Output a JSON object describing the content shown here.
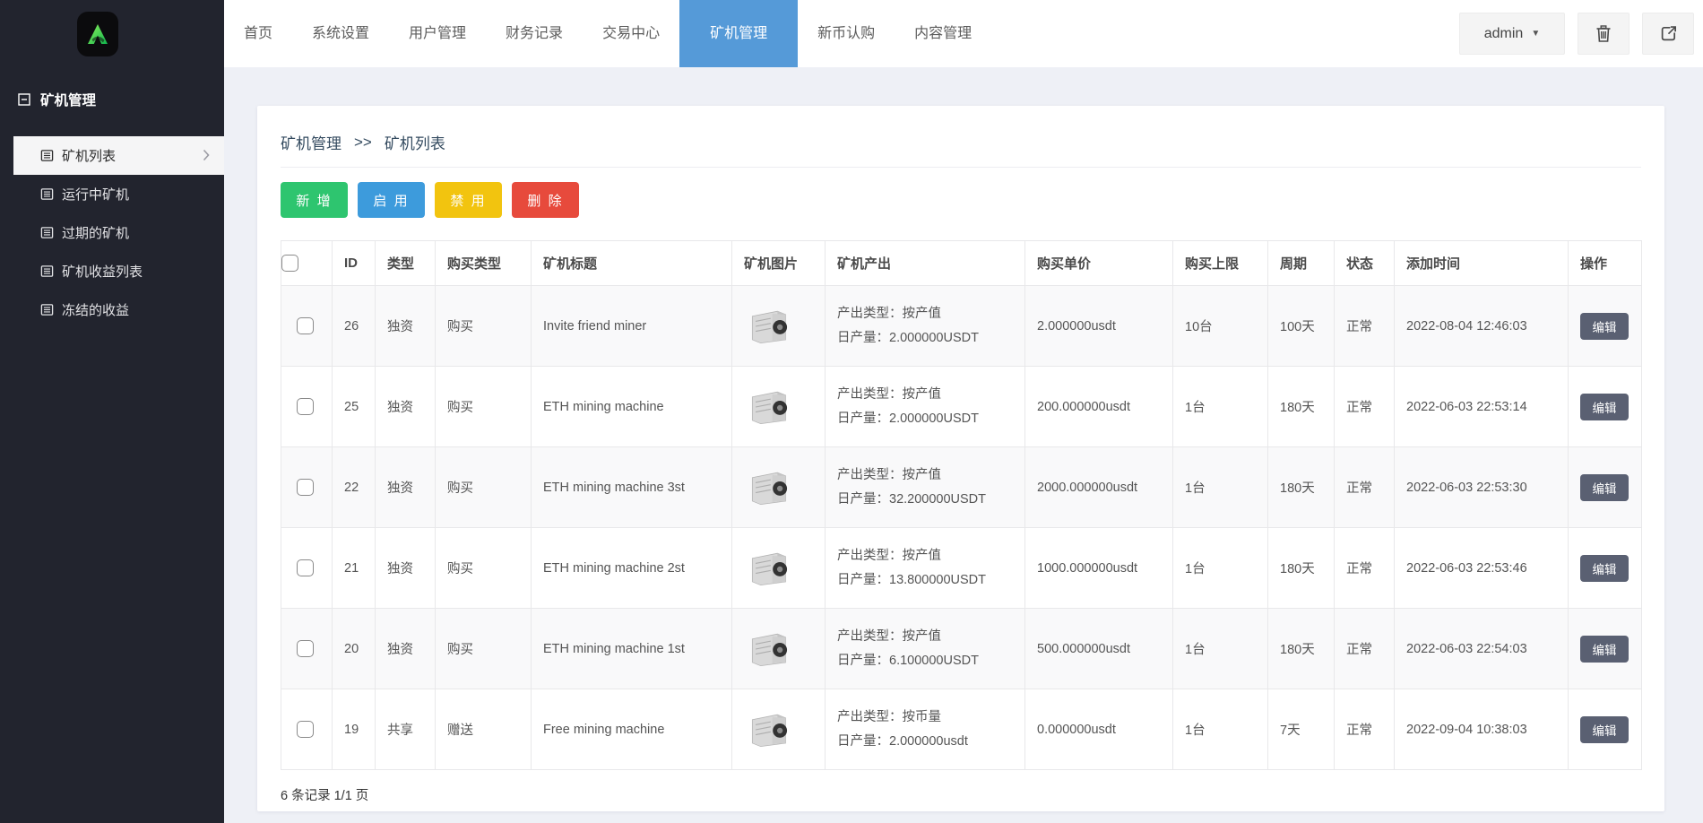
{
  "header": {
    "nav": [
      {
        "label": "首页",
        "active": false
      },
      {
        "label": "系统设置",
        "active": false
      },
      {
        "label": "用户管理",
        "active": false
      },
      {
        "label": "财务记录",
        "active": false
      },
      {
        "label": "交易中心",
        "active": false
      },
      {
        "label": "矿机管理",
        "active": true
      },
      {
        "label": "新币认购",
        "active": false
      },
      {
        "label": "内容管理",
        "active": false
      }
    ],
    "user": {
      "name": "admin",
      "caret": "▼"
    },
    "icons": [
      "brand-a-logo",
      "trash-icon",
      "share-icon"
    ]
  },
  "sidebar": {
    "section": {
      "label": "矿机管理",
      "icon": "collapse-minus-icon"
    },
    "items": [
      {
        "label": "矿机列表",
        "icon": "list-icon",
        "active": true
      },
      {
        "label": "运行中矿机",
        "icon": "list-icon",
        "active": false
      },
      {
        "label": "过期的矿机",
        "icon": "list-icon",
        "active": false
      },
      {
        "label": "矿机收益列表",
        "icon": "list-icon",
        "active": false
      },
      {
        "label": "冻结的收益",
        "icon": "list-icon",
        "active": false
      }
    ]
  },
  "breadcrumb": {
    "parent": "矿机管理",
    "separator": ">>",
    "current": "矿机列表"
  },
  "toolbar": {
    "add_label": "新 增",
    "enable_label": "启 用",
    "disable_label": "禁 用",
    "delete_label": "删 除"
  },
  "table": {
    "columns": [
      "ID",
      "类型",
      "购买类型",
      "矿机标题",
      "矿机图片",
      "矿机产出",
      "购买单价",
      "购买上限",
      "周期",
      "状态",
      "添加时间",
      "操作"
    ],
    "rows": [
      {
        "id": "26",
        "type": "独资",
        "buy_type": "购买",
        "buy_type_class": "buy-green",
        "title": "Invite friend miner",
        "output_type": "产出类型：按产值",
        "output_daily": "日产量：2.000000USDT",
        "price": "2.000000usdt",
        "limit": "10台",
        "period": "100天",
        "status": "正常",
        "added": "2022-08-04 12:46:03",
        "action": "编辑"
      },
      {
        "id": "25",
        "type": "独资",
        "buy_type": "购买",
        "buy_type_class": "buy-green",
        "title": "ETH mining machine",
        "output_type": "产出类型：按产值",
        "output_daily": "日产量：2.000000USDT",
        "price": "200.000000usdt",
        "limit": "1台",
        "period": "180天",
        "status": "正常",
        "added": "2022-06-03 22:53:14",
        "action": "编辑"
      },
      {
        "id": "22",
        "type": "独资",
        "buy_type": "购买",
        "buy_type_class": "buy-green",
        "title": "ETH mining machine 3st",
        "output_type": "产出类型：按产值",
        "output_daily": "日产量：32.200000USDT",
        "price": "2000.000000usdt",
        "limit": "1台",
        "period": "180天",
        "status": "正常",
        "added": "2022-06-03 22:53:30",
        "action": "编辑"
      },
      {
        "id": "21",
        "type": "独资",
        "buy_type": "购买",
        "buy_type_class": "buy-green",
        "title": "ETH mining machine 2st",
        "output_type": "产出类型：按产值",
        "output_daily": "日产量：13.800000USDT",
        "price": "1000.000000usdt",
        "limit": "1台",
        "period": "180天",
        "status": "正常",
        "added": "2022-06-03 22:53:46",
        "action": "编辑"
      },
      {
        "id": "20",
        "type": "独资",
        "buy_type": "购买",
        "buy_type_class": "buy-green",
        "title": "ETH mining machine 1st",
        "output_type": "产出类型：按产值",
        "output_daily": "日产量：6.100000USDT",
        "price": "500.000000usdt",
        "limit": "1台",
        "period": "180天",
        "status": "正常",
        "added": "2022-06-03 22:54:03",
        "action": "编辑"
      },
      {
        "id": "19",
        "type": "共享",
        "buy_type": "赠送",
        "buy_type_class": "buy-red",
        "title": "Free mining machine",
        "output_type": "产出类型：按币量",
        "output_daily": "日产量：2.000000usdt",
        "price": "0.000000usdt",
        "limit": "1台",
        "period": "7天",
        "status": "正常",
        "added": "2022-09-04 10:38:03",
        "action": "编辑"
      }
    ],
    "footer": "6 条记录 1/1 页"
  },
  "colors": {
    "sidebar_bg": "#22242e",
    "nav_active_bg": "#559ad8",
    "page_bg": "#eef0f6",
    "btn_add": "#2ec56f",
    "btn_enable": "#3d9bdc",
    "btn_disable": "#f2c40f",
    "btn_delete": "#e74a3c",
    "buy_green": "#38a01e",
    "gift_red": "#e2382f",
    "edit_btn": "#5a6072"
  }
}
